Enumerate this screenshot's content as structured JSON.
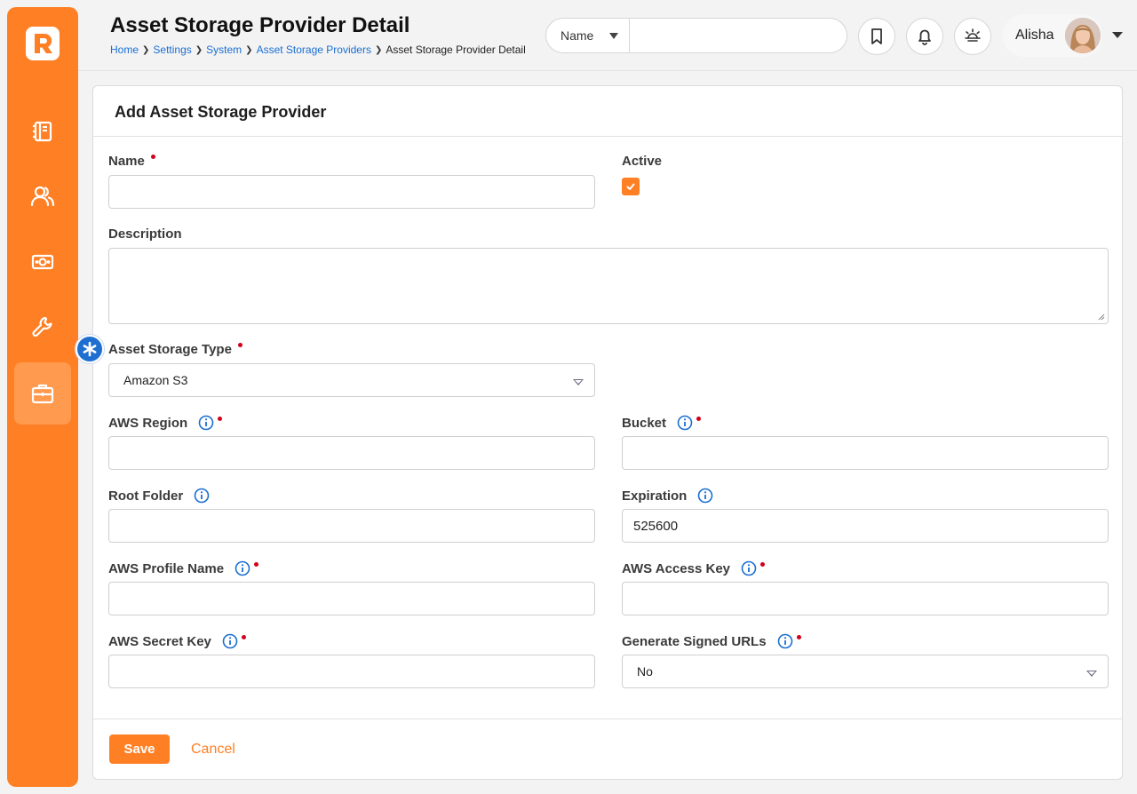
{
  "header": {
    "title": "Asset Storage Provider Detail",
    "breadcrumb": [
      "Home",
      "Settings",
      "System",
      "Asset Storage Providers"
    ],
    "breadcrumb_current": "Asset Storage Provider Detail",
    "search": {
      "scope": "Name",
      "value": ""
    },
    "user_name": "Alisha"
  },
  "sidebar": {
    "items": [
      {
        "icon": "notebook-icon"
      },
      {
        "icon": "people-icon"
      },
      {
        "icon": "money-icon"
      },
      {
        "icon": "wrench-icon"
      },
      {
        "icon": "briefcase-icon",
        "active": true
      }
    ]
  },
  "form": {
    "title": "Add Asset Storage Provider",
    "name": {
      "label": "Name",
      "value": ""
    },
    "active": {
      "label": "Active",
      "checked": true
    },
    "description": {
      "label": "Description",
      "value": ""
    },
    "asset_storage_type": {
      "label": "Asset Storage Type",
      "value": "Amazon S3"
    },
    "aws_region": {
      "label": "AWS Region",
      "value": ""
    },
    "bucket": {
      "label": "Bucket",
      "value": ""
    },
    "root_folder": {
      "label": "Root Folder",
      "value": ""
    },
    "expiration": {
      "label": "Expiration",
      "value": "525600"
    },
    "aws_profile_name": {
      "label": "AWS Profile Name",
      "value": ""
    },
    "aws_access_key": {
      "label": "AWS Access Key",
      "value": ""
    },
    "aws_secret_key": {
      "label": "AWS Secret Key",
      "value": ""
    },
    "generate_signed_urls": {
      "label": "Generate Signed URLs",
      "value": "No"
    }
  },
  "actions": {
    "save": "Save",
    "cancel": "Cancel"
  },
  "colors": {
    "accent": "#ff7f24",
    "link": "#1a6fd1",
    "required": "#d0021b"
  }
}
